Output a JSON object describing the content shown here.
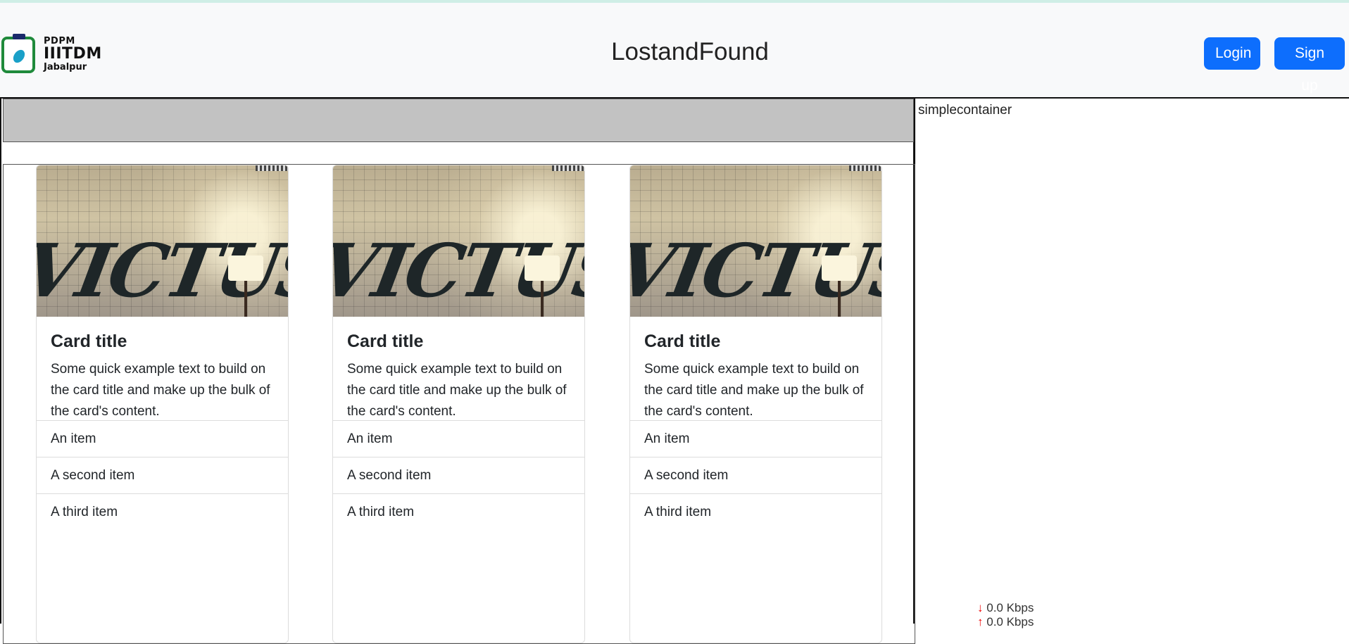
{
  "header": {
    "logo": {
      "line1": "PDPM",
      "line2": "IIITDM",
      "line3": "Jabalpur"
    },
    "brand": "LostandFound",
    "login_label": "Login",
    "signup_label": "Sign up"
  },
  "side": {
    "label": "simplecontainer"
  },
  "cards": [
    {
      "image_text": "VICTUS",
      "title": "Card title",
      "text": "Some quick example text to build on the card title and make up the bulk of the card's content.",
      "items": [
        "An item",
        "A second item",
        "A third item"
      ]
    },
    {
      "image_text": "VICTUS",
      "title": "Card title",
      "text": "Some quick example text to build on the card title and make up the bulk of the card's content.",
      "items": [
        "An item",
        "A second item",
        "A third item"
      ]
    },
    {
      "image_text": "VICTUS",
      "title": "Card title",
      "text": "Some quick example text to build on the card title and make up the bulk of the card's content.",
      "items": [
        "An item",
        "A second item",
        "A third item"
      ]
    }
  ],
  "net_speed": {
    "down": "0.0 Kbps",
    "up": "0.0 Kbps"
  },
  "colors": {
    "primary": "#0d6efd",
    "navbar_bg": "#f8f9fa",
    "grey_bar": "#c2c2c2"
  }
}
